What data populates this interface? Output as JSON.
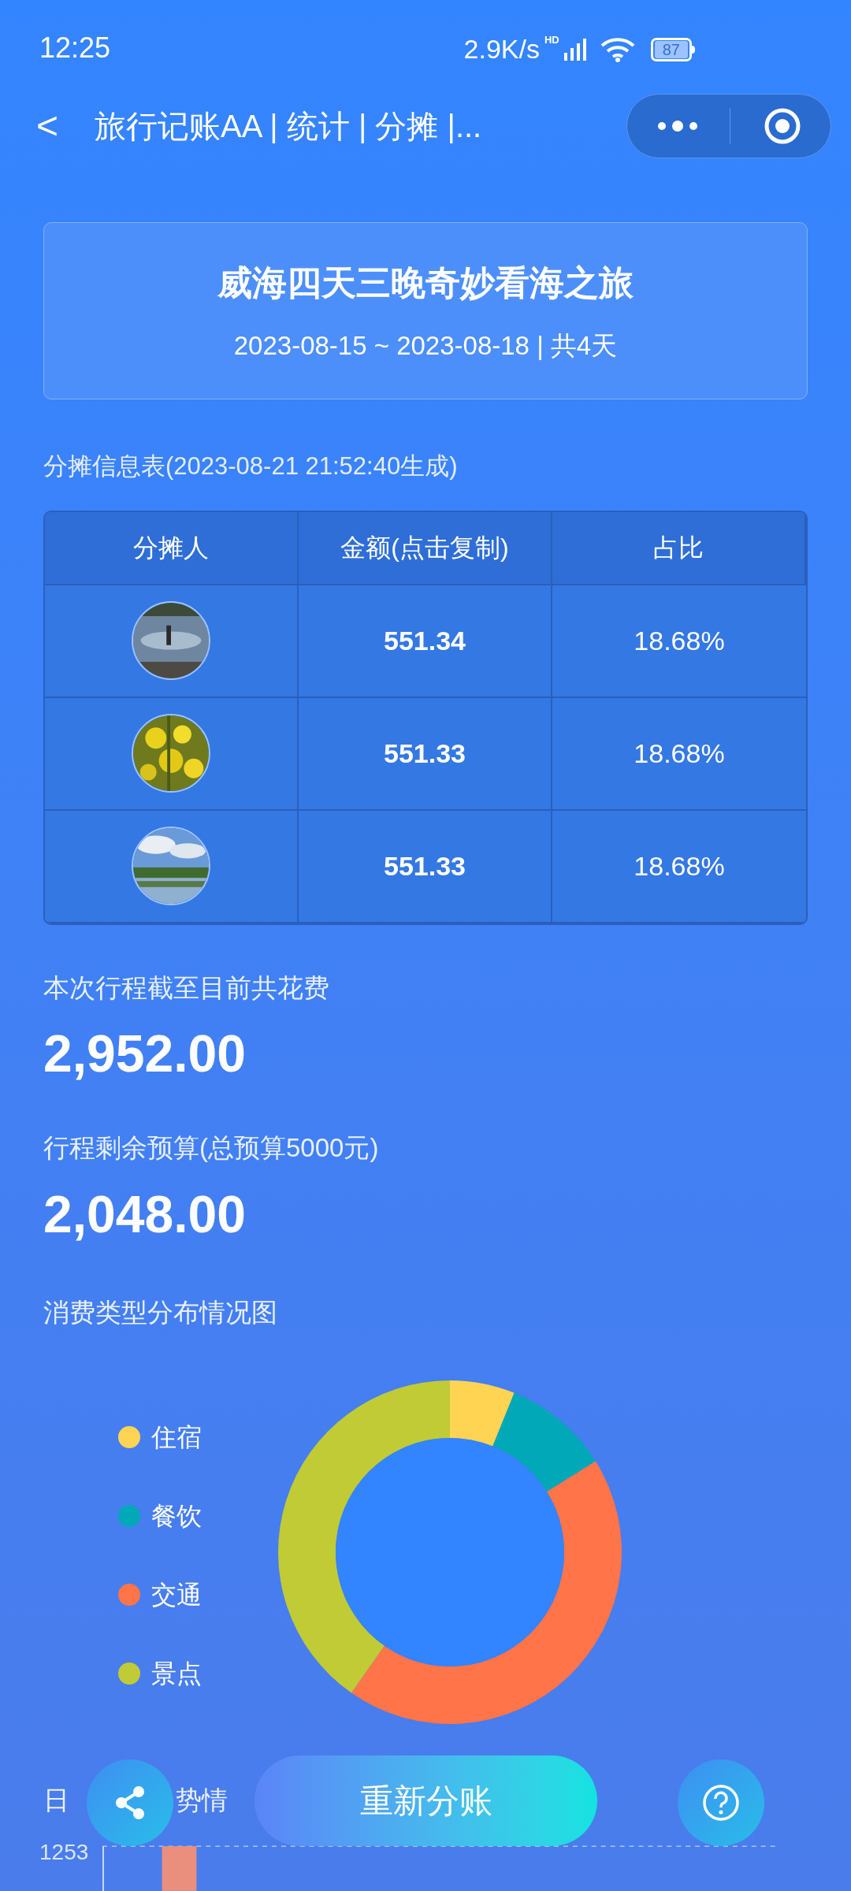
{
  "status_bar": {
    "time": "12:25",
    "net_speed": "2.9K/s",
    "hd": "HD",
    "battery": "87"
  },
  "nav": {
    "back": "<",
    "title": "旅行记账AA | 统计 | 分摊 |..."
  },
  "trip": {
    "title": "威海四天三晚奇妙看海之旅",
    "dates": "2023-08-15 ~ 2023-08-18 | 共4天"
  },
  "split_table": {
    "caption": "分摊信息表(2023-08-21 21:52:40生成)",
    "columns": [
      "分摊人",
      "金额(点击复制)",
      "占比"
    ],
    "rows": [
      {
        "amount": "551.34",
        "share": "18.68%"
      },
      {
        "amount": "551.33",
        "share": "18.68%"
      },
      {
        "amount": "551.33",
        "share": "18.68%"
      }
    ]
  },
  "total_spent": {
    "label": "本次行程截至目前共花费",
    "value": "2,952.00"
  },
  "remaining_budget": {
    "label": "行程剩余预算(总预算5000元)",
    "value": "2,048.00"
  },
  "category_chart": {
    "title": "消费类型分布情况图",
    "legend": [
      {
        "label": "住宿",
        "color": "#ffd452"
      },
      {
        "label": "餐饮",
        "color": "#00a8b8"
      },
      {
        "label": "交通",
        "color": "#ff7448"
      },
      {
        "label": "景点",
        "color": "#c0cb36"
      }
    ]
  },
  "trend_chart": {
    "title_parts": [
      "日",
      "势情"
    ],
    "y_tick": "1253"
  },
  "actions": {
    "resplit": "重新分账"
  }
}
